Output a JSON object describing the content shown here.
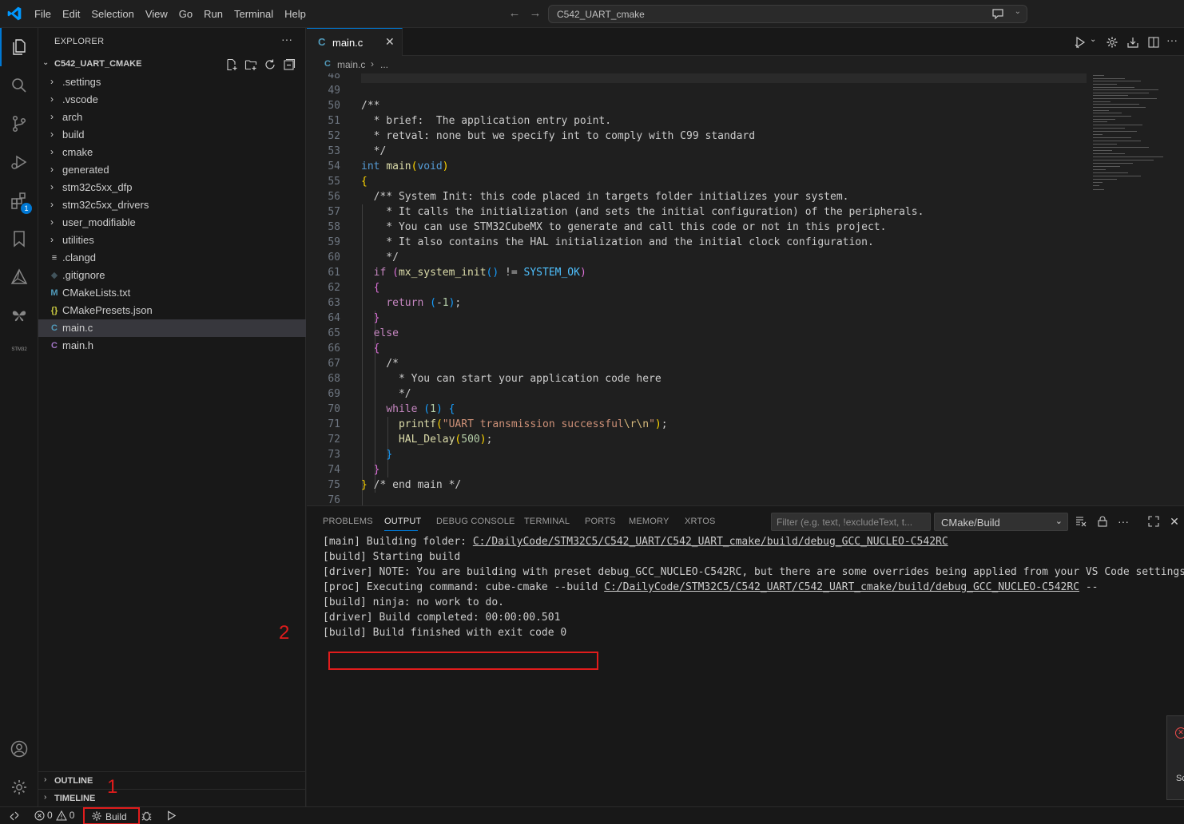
{
  "menu": [
    "File",
    "Edit",
    "Selection",
    "View",
    "Go",
    "Run",
    "Terminal",
    "Help"
  ],
  "search": {
    "title": "C542_UART_cmake"
  },
  "activity": {
    "extensions_badge": "1",
    "stm32_label": "STM32"
  },
  "explorer": {
    "title": "EXPLORER",
    "more": "···",
    "project": "C542_UART_CMAKE",
    "items": [
      {
        "name": ".settings",
        "kind": "folder"
      },
      {
        "name": ".vscode",
        "kind": "folder"
      },
      {
        "name": "arch",
        "kind": "folder"
      },
      {
        "name": "build",
        "kind": "folder"
      },
      {
        "name": "cmake",
        "kind": "folder"
      },
      {
        "name": "generated",
        "kind": "folder"
      },
      {
        "name": "stm32c5xx_dfp",
        "kind": "folder"
      },
      {
        "name": "stm32c5xx_drivers",
        "kind": "folder"
      },
      {
        "name": "user_modifiable",
        "kind": "folder"
      },
      {
        "name": "utilities",
        "kind": "folder"
      },
      {
        "name": ".clangd",
        "kind": "file",
        "icon": "≡",
        "color": "#cccccc"
      },
      {
        "name": ".gitignore",
        "kind": "file",
        "icon": "◆",
        "color": "#41535b"
      },
      {
        "name": "CMakeLists.txt",
        "kind": "file",
        "icon": "M",
        "color": "#519aba"
      },
      {
        "name": "CMakePresets.json",
        "kind": "file",
        "icon": "{}",
        "color": "#cbcb41"
      },
      {
        "name": "main.c",
        "kind": "file",
        "icon": "C",
        "color": "#519aba",
        "selected": true
      },
      {
        "name": "main.h",
        "kind": "file",
        "icon": "C",
        "color": "#a074c4"
      }
    ],
    "outline": "OUTLINE",
    "timeline": "TIMELINE"
  },
  "editor": {
    "tab": {
      "label": "main.c",
      "icon": "C",
      "close": "✕"
    },
    "breadcrumb": {
      "file": "main.c",
      "sep": "›",
      "more": "..."
    },
    "lines": [
      {
        "n": "48",
        "html": ""
      },
      {
        "n": "49",
        "html": ""
      },
      {
        "n": "50",
        "html": "<span class='c'>/**</span>"
      },
      {
        "n": "51",
        "html": "<span class='c'>  * brief:  The application entry point.</span>"
      },
      {
        "n": "52",
        "html": "<span class='c'>  * retval: none but we specify int to comply with C99 standard</span>"
      },
      {
        "n": "53",
        "html": "<span class='c'>  */</span>"
      },
      {
        "n": "54",
        "html": "<span class='t'>int</span> <span class='f'>main</span><span class='p1'>(</span><span class='t'>void</span><span class='p1'>)</span>"
      },
      {
        "n": "55",
        "html": "<span class='p1'>{</span>"
      },
      {
        "n": "56",
        "html": "<span class='c'>  /** System Init: this code placed in targets folder initializes your system.</span>"
      },
      {
        "n": "57",
        "html": "<span class='c'>    * It calls the initialization (and sets the initial configuration) of the peripherals.</span>"
      },
      {
        "n": "58",
        "html": "<span class='c'>    * You can use STM32CubeMX to generate and call this code or not in this project.</span>"
      },
      {
        "n": "59",
        "html": "<span class='c'>    * It also contains the HAL initialization and the initial clock configuration.</span>"
      },
      {
        "n": "60",
        "html": "<span class='c'>    */</span>"
      },
      {
        "n": "61",
        "html": "  <span class='k'>if</span> <span class='p2'>(</span><span class='f'>mx_system_init</span><span class='p3'>()</span> != <span class='m'>SYSTEM_OK</span><span class='p2'>)</span>"
      },
      {
        "n": "62",
        "html": "  <span class='p2'>{</span>"
      },
      {
        "n": "63",
        "html": "    <span class='k'>return</span> <span class='p3'>(</span>-<span class='n'>1</span><span class='p3'>)</span>;"
      },
      {
        "n": "64",
        "html": "  <span class='p2'>}</span>"
      },
      {
        "n": "65",
        "html": "  <span class='k'>else</span>"
      },
      {
        "n": "66",
        "html": "  <span class='p2'>{</span>"
      },
      {
        "n": "67",
        "html": "<span class='c'>    /*</span>"
      },
      {
        "n": "68",
        "html": "<span class='c'>      * You can start your application code here</span>"
      },
      {
        "n": "69",
        "html": "<span class='c'>      */</span>"
      },
      {
        "n": "70",
        "html": "    <span class='k'>while</span> <span class='p3'>(</span><span class='n'>1</span><span class='p3'>)</span> <span class='p3'>{</span>"
      },
      {
        "n": "71",
        "html": "      <span class='f'>printf</span><span class='p1'>(</span><span class='s'>\"UART transmission successful</span><span class='e'>\\r\\n</span><span class='s'>\"</span><span class='p1'>)</span>;"
      },
      {
        "n": "72",
        "html": "      <span class='f'>HAL_Delay</span><span class='p1'>(</span><span class='n'>500</span><span class='p1'>)</span>;"
      },
      {
        "n": "73",
        "html": "    <span class='p3'>}</span>"
      },
      {
        "n": "74",
        "html": "  <span class='p2'>}</span>"
      },
      {
        "n": "75",
        "html": "<span class='p1'>}</span> <span class='c'>/* end main */</span>"
      },
      {
        "n": "76",
        "html": ""
      }
    ]
  },
  "panel": {
    "tabs": [
      "PROBLEMS",
      "OUTPUT",
      "DEBUG CONSOLE",
      "TERMINAL",
      "PORTS",
      "MEMORY",
      "XRTOS"
    ],
    "active_tab": "OUTPUT",
    "filter_placeholder": "Filter (e.g. text, !excludeText, t...",
    "channel": "CMake/Build",
    "output": [
      {
        "pre": "[main] Building folder: ",
        "link": "C:/DailyCode/STM32C5/C542_UART/C542_UART_cmake/build/debug_GCC_NUCLEO-C542RC",
        "post": ""
      },
      {
        "pre": "[build] Starting build",
        "link": "",
        "post": ""
      },
      {
        "pre": "[driver] NOTE: You are building with preset debug_GCC_NUCLEO-C542RC, but there are some overrides being applied from your VS Code settings.",
        "link": "",
        "post": ""
      },
      {
        "pre": "[proc] Executing command: cube-cmake --build ",
        "link": "C:/DailyCode/STM32C5/C542_UART/C542_UART_cmake/build/debug_GCC_NUCLEO-C542RC",
        "post": " --"
      },
      {
        "pre": "[build] ninja: no work to do.",
        "link": "",
        "post": ""
      },
      {
        "pre": "[driver] Build completed: 00:00:00.501",
        "link": "",
        "post": ""
      },
      {
        "pre": "[build] Build finished with exit code 0",
        "link": "",
        "post": ""
      }
    ]
  },
  "annotations": {
    "marker1": "1",
    "marker2": "2"
  },
  "notification": {
    "text": "Sc"
  },
  "status": {
    "errors": "0",
    "warnings": "0",
    "build": "Build"
  }
}
